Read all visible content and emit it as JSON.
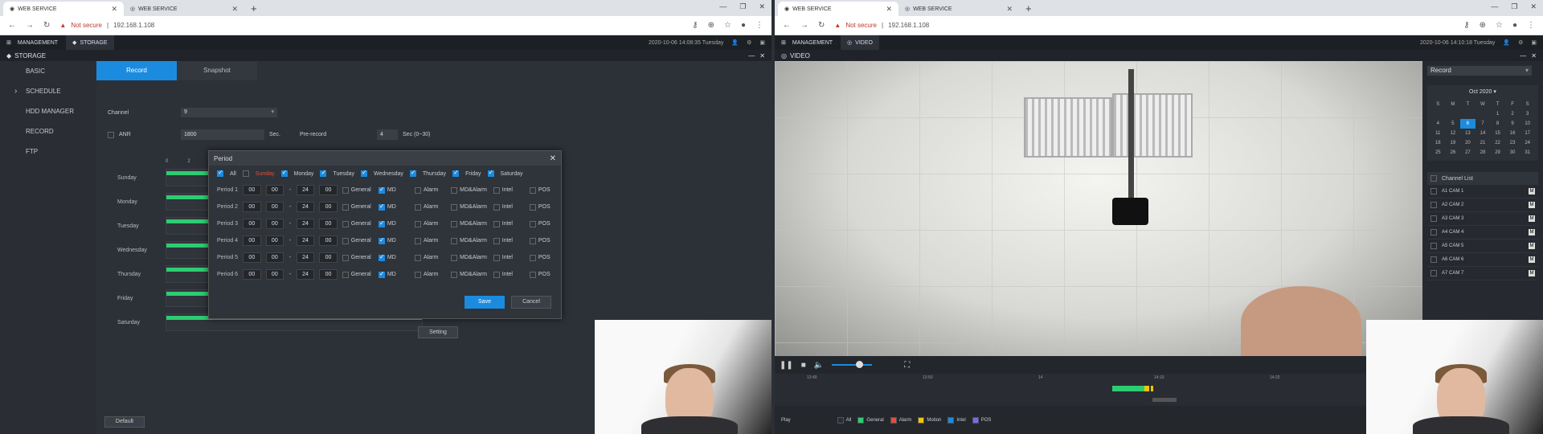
{
  "left": {
    "browser": {
      "tabs": [
        {
          "label": "WEB SERVICE"
        },
        {
          "label": "WEB SERVICE"
        }
      ],
      "security": "Not secure",
      "url": "192.168.1.108"
    },
    "app": {
      "management": "MANAGEMENT",
      "active_tab": "STORAGE",
      "datetime": "2020-10-06 14:08:35 Tuesday",
      "section_title": "STORAGE"
    },
    "sidebar": [
      {
        "label": "BASIC"
      },
      {
        "label": "SCHEDULE"
      },
      {
        "label": "HDD MANAGER"
      },
      {
        "label": "RECORD"
      },
      {
        "label": "FTP"
      }
    ],
    "subtabs": [
      {
        "label": "Record"
      },
      {
        "label": "Snapshot"
      }
    ],
    "form": {
      "channel_label": "Channel",
      "channel_value": "9",
      "anr_label": "ANR",
      "anr_value": "1800",
      "anr_unit": "Sec.",
      "prerecord_label": "Pre-record",
      "prerecord_value": "4",
      "prerecord_unit": "Sec (0~30)"
    },
    "schedule": {
      "hours": [
        "0",
        "2",
        "4"
      ],
      "days": [
        "Sunday",
        "Monday",
        "Tuesday",
        "Wednesday",
        "Thursday",
        "Friday",
        "Saturday"
      ]
    },
    "setting_button": "Setting",
    "default_button": "Default",
    "dialog": {
      "title": "Period",
      "all_label": "All",
      "days": [
        "Sunday",
        "Monday",
        "Tuesday",
        "Wednesday",
        "Thursday",
        "Friday",
        "Saturday"
      ],
      "periods": [
        {
          "label": "Period 1",
          "sh": "00",
          "sm": "00",
          "eh": "24",
          "em": "00"
        },
        {
          "label": "Period 2",
          "sh": "00",
          "sm": "00",
          "eh": "24",
          "em": "00"
        },
        {
          "label": "Period 3",
          "sh": "00",
          "sm": "00",
          "eh": "24",
          "em": "00"
        },
        {
          "label": "Period 4",
          "sh": "00",
          "sm": "00",
          "eh": "24",
          "em": "00"
        },
        {
          "label": "Period 5",
          "sh": "00",
          "sm": "00",
          "eh": "24",
          "em": "00"
        },
        {
          "label": "Period 6",
          "sh": "00",
          "sm": "00",
          "eh": "24",
          "em": "00"
        }
      ],
      "options": [
        "General",
        "MD",
        "Alarm",
        "MD&Alarm",
        "Intel",
        "POS"
      ],
      "save": "Save",
      "cancel": "Cancel"
    }
  },
  "right": {
    "browser": {
      "tabs": [
        {
          "label": "WEB SERVICE"
        },
        {
          "label": "WEB SERVICE"
        }
      ],
      "security": "Not secure",
      "url": "192.168.1.108"
    },
    "app": {
      "management": "MANAGEMENT",
      "active_tab": "VIDEO",
      "datetime": "2020-10-06 14:10:18 Tuesday",
      "section_title": "VIDEO"
    },
    "record_select": "Record",
    "calendar": {
      "month": "Oct 2020",
      "weekdays": [
        "S",
        "M",
        "T",
        "W",
        "T",
        "F",
        "S"
      ],
      "weeks": [
        [
          "",
          "",
          "",
          "",
          "1",
          "2",
          "3"
        ],
        [
          "4",
          "5",
          "6",
          "7",
          "8",
          "9",
          "10"
        ],
        [
          "11",
          "12",
          "13",
          "14",
          "15",
          "16",
          "17"
        ],
        [
          "18",
          "19",
          "20",
          "21",
          "22",
          "23",
          "24"
        ],
        [
          "25",
          "26",
          "27",
          "28",
          "29",
          "30",
          "31"
        ]
      ],
      "today": "6"
    },
    "channel_list": {
      "title": "Channel List",
      "channels": [
        "A1 CAM 1",
        "A2 CAM 2",
        "A3 CAM 3",
        "A4 CAM 4",
        "A5 CAM 5",
        "A6 CAM 6",
        "A7 CAM 7"
      ]
    },
    "timeline_ticks": [
      "13:40",
      "13:50",
      "14",
      "14:10",
      "14:20"
    ],
    "legend": {
      "play": "Play",
      "items": [
        {
          "label": "All",
          "color": "#2a2e34"
        },
        {
          "label": "General",
          "color": "#2ecc71"
        },
        {
          "label": "Alarm",
          "color": "#e74c3c"
        },
        {
          "label": "Motion",
          "color": "#f1c40f"
        },
        {
          "label": "Intel",
          "color": "#1b8be0"
        },
        {
          "label": "POS",
          "color": "#7b68ee"
        }
      ]
    }
  }
}
